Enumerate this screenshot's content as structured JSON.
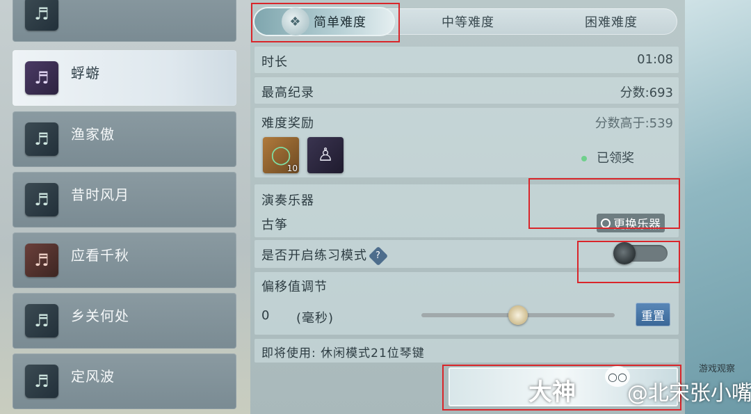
{
  "sidebar": {
    "songs": [
      {
        "name": "",
        "icon": "music-book-icon"
      },
      {
        "name": "蜉蝣",
        "icon": "music-book-icon",
        "active": true
      },
      {
        "name": "渔家傲",
        "icon": "music-book-icon"
      },
      {
        "name": "昔时风月",
        "icon": "music-book-icon"
      },
      {
        "name": "应看千秋",
        "icon": "music-book-icon"
      },
      {
        "name": "乡关何处",
        "icon": "music-book-icon"
      },
      {
        "name": "定风波",
        "icon": "music-book-icon"
      }
    ]
  },
  "tabs": [
    {
      "label": "简单难度",
      "active": true
    },
    {
      "label": "中等难度"
    },
    {
      "label": "困难难度"
    }
  ],
  "details": {
    "duration_label": "时长",
    "duration_value": "01:08",
    "record_label": "最高纪录",
    "record_value": "分数:693",
    "reward_label": "难度奖励",
    "reward_condition": "分数高于:539",
    "reward_item_qty": "10",
    "reward_status": "已领奖",
    "instrument_label": "演奏乐器",
    "instrument_value": "古筝",
    "change_instrument": "更换乐器",
    "practice_label": "是否开启练习模式",
    "practice_enabled": false,
    "offset_label": "偏移值调节",
    "offset_value": "0",
    "offset_unit": "(毫秒)",
    "offset_level_fraction": 0.5,
    "reset_label": "重置",
    "mode_text": "即将使用: 休闲模式21位琴键"
  },
  "watermark": {
    "small": "游戏观察",
    "big_left": "大神",
    "big_right": "@北宋张小嘴"
  },
  "colors": {
    "highlight": "#d9252a",
    "reset_button": "#4a78a8"
  }
}
